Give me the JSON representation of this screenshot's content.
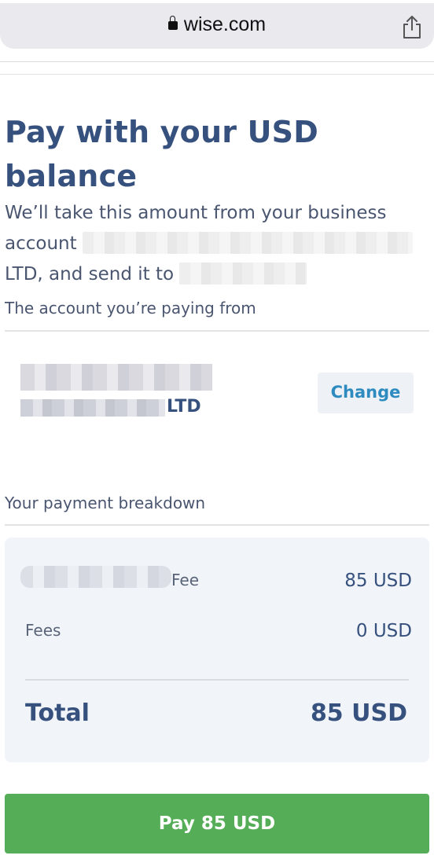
{
  "browser": {
    "url": "wise.com"
  },
  "page": {
    "title": "Pay with your USD balance",
    "subtitle_part1": "We’ll take this amount from your business account",
    "subtitle_part2": "LTD, and send it to"
  },
  "from_section": {
    "label": "The account you’re paying from",
    "account_suffix": "LTD",
    "change_label": "Change"
  },
  "breakdown": {
    "label": "Your payment breakdown",
    "rows": [
      {
        "label": "Fee",
        "value": "85 USD"
      },
      {
        "label": "Fees",
        "value": "0 USD"
      }
    ],
    "total_label": "Total",
    "total_value": "85 USD"
  },
  "pay_button": {
    "label": "Pay 85 USD"
  },
  "colors": {
    "brand_navy": "#37517e",
    "link_blue": "#2e8bc0",
    "pay_green": "#55ad58"
  }
}
